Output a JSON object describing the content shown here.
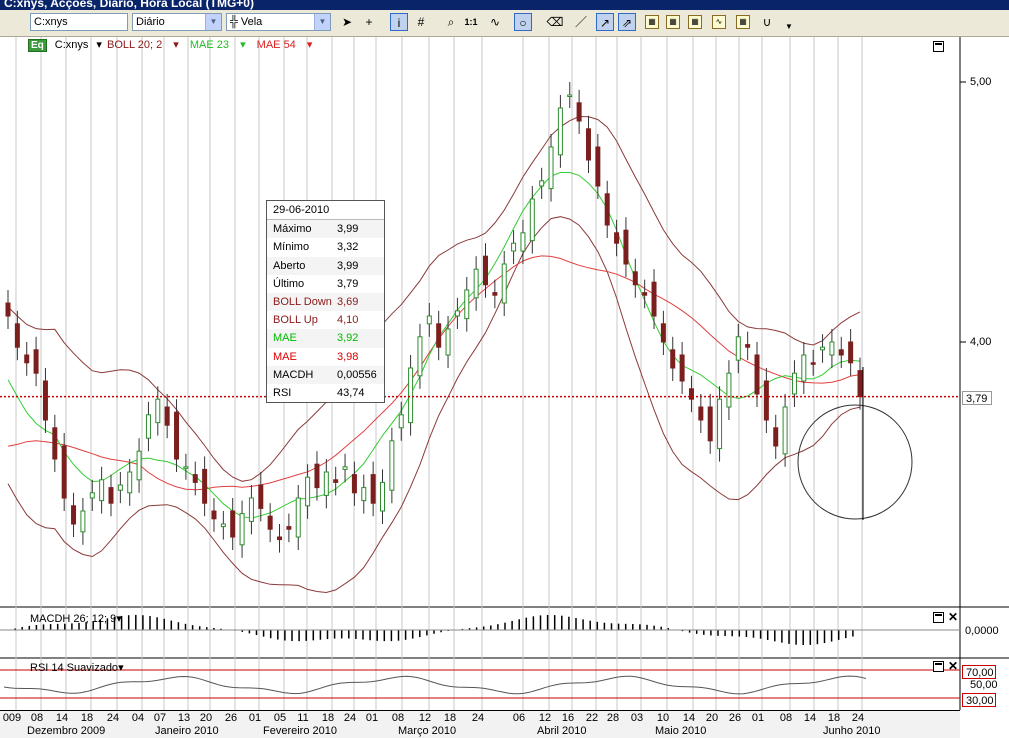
{
  "window": {
    "title": "C:xnys, Acções, Diário, Hora Local (TMG+0)"
  },
  "toolbar": {
    "symbol": "C:xnys",
    "interval": "Diário",
    "chart_type": "Vela",
    "scale_label": "1:1"
  },
  "legend": {
    "eq_badge": "Eq",
    "symbol": "C:xnys",
    "boll": "BOLL 20; 2",
    "mae1": "MAE 23",
    "mae2": "MAE 54"
  },
  "tooltip": {
    "date": "29-06-2010",
    "rows": [
      {
        "k": "Máximo",
        "v": "3,99",
        "color": "#000000"
      },
      {
        "k": "Mínimo",
        "v": "3,32",
        "color": "#000000"
      },
      {
        "k": "Aberto",
        "v": "3,99",
        "color": "#000000"
      },
      {
        "k": "Último",
        "v": "3,79",
        "color": "#000000"
      },
      {
        "k": "BOLL Down",
        "v": "3,69",
        "color": "#8b1a1a"
      },
      {
        "k": "BOLL Up",
        "v": "4,10",
        "color": "#8b1a1a"
      },
      {
        "k": "MAE",
        "v": "3,92",
        "color": "#00bb00"
      },
      {
        "k": "MAE",
        "v": "3,98",
        "color": "#dd0000"
      },
      {
        "k": "MACDH",
        "v": "0,00556",
        "color": "#000000"
      },
      {
        "k": "RSI",
        "v": "43,74",
        "color": "#000000"
      }
    ]
  },
  "price_axis": {
    "labels": [
      "5,00",
      "4,00"
    ],
    "last_price": "3,79"
  },
  "macd_pane": {
    "label": "MACDH 26; 12; 9",
    "axis_label": "0,0000"
  },
  "rsi_pane": {
    "label": "RSI 14 Suavizado",
    "axis_labels": [
      "70,00",
      "50,00",
      "30,00"
    ]
  },
  "date_axis": {
    "days": [
      "009",
      "08",
      "14",
      "18",
      "24",
      "04",
      "07",
      "13",
      "20",
      "26",
      "01",
      "05",
      "11",
      "18",
      "24",
      "01",
      "08",
      "12",
      "18",
      "24",
      "06",
      "12",
      "16",
      "22",
      "28",
      "03",
      "10",
      "14",
      "20",
      "26",
      "01",
      "08",
      "14",
      "18",
      "24"
    ],
    "months": [
      "Dezembro 2009",
      "Janeiro 2010",
      "Fevereiro 2010",
      "Março 2010",
      "Abril 2010",
      "Maio 2010",
      "Junho 2010"
    ]
  },
  "colors": {
    "up": "#2e8b2e",
    "down": "#7b1e1e",
    "boll": "#8b3a3a",
    "mae_fast": "#33cc33",
    "mae_slow": "#e04040",
    "last_line": "#cc0000"
  }
}
